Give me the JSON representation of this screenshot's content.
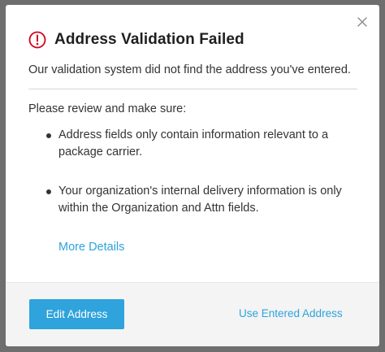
{
  "dialog": {
    "title": "Address Validation Failed",
    "subtitle": "Our validation system did not find the address you've entered.",
    "review_heading": "Please review and make sure:",
    "bullets": [
      "Address fields only contain information relevant to a package carrier.",
      "Your organization's internal delivery information is only within the Organization and Attn fields."
    ],
    "more_details_label": "More Details",
    "icons": {
      "alert": "alert-circle-icon",
      "close": "close-icon"
    }
  },
  "footer": {
    "primary_label": "Edit Address",
    "secondary_label": "Use Entered Address"
  },
  "colors": {
    "accent": "#2ea3dc",
    "alert": "#d0021b",
    "overlay": "#6e6e6e",
    "footer_bg": "#f4f4f4"
  }
}
